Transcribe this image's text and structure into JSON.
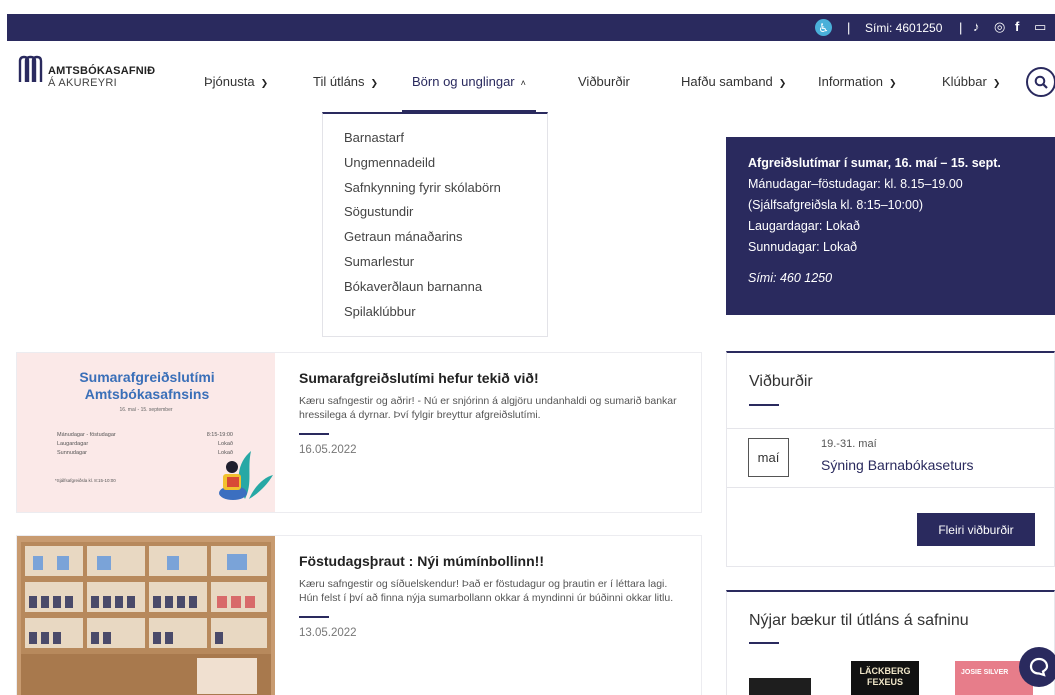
{
  "topbar": {
    "accessibility_icon": "accessibility-icon",
    "phone": "Sími: 4601250",
    "social": [
      "tiktok-icon",
      "instagram-icon",
      "facebook-icon",
      "youtube-icon"
    ]
  },
  "brand": {
    "name": "AMTSBÓKASAFNIÐ",
    "sub": "Á AKUREYRI"
  },
  "nav": {
    "items": [
      {
        "label": "Þjónusta",
        "has_dropdown": true
      },
      {
        "label": "Til útláns",
        "has_dropdown": true
      },
      {
        "label": "Börn og unglingar",
        "has_dropdown": true,
        "open": true
      },
      {
        "label": "Viðburðir",
        "has_dropdown": false
      },
      {
        "label": "Hafðu samband",
        "has_dropdown": true
      },
      {
        "label": "Information",
        "has_dropdown": true
      },
      {
        "label": "Klúbbar",
        "has_dropdown": true
      }
    ],
    "search_icon": "search-icon"
  },
  "dropdown": {
    "items": [
      "Barnastarf",
      "Ungmennadeild",
      "Safnkynning fyrir skólabörn",
      "Sögustundir",
      "Getraun mánaðarins",
      "Sumarlestur",
      "Bókaverðlaun barnanna",
      "Spilaklúbbur"
    ]
  },
  "hours": {
    "title": "Afgreiðslutímar í sumar, 16. maí – 15. sept.",
    "lines": [
      "Mánudagar–föstudagar: kl. 8.15–19.00",
      "(Sjálfsafgreiðsla kl. 8:15–10:00)",
      "Laugardagar: Lokað",
      "Sunnudagar: Lokað"
    ],
    "phone": "Sími: 460 1250"
  },
  "news": [
    {
      "title": "Sumarafgreiðslutími hefur tekið við!",
      "text": "Kæru safngestir og aðrir! - Nú er snjórinn á algjöru undanhaldi og sumarið bankar hressilega á dyrnar. Því fylgir breyttur afgreiðslutími.",
      "date": "16.05.2022",
      "image": {
        "title": "Sumarafgreiðslutími Amtsbókasafnsins",
        "range": "16. maí - 15. september",
        "rows": [
          {
            "day": "Mánudagar - föstudagar",
            "time": "8:15-19:00"
          },
          {
            "day": "Laugardagar",
            "time": "Lokað"
          },
          {
            "day": "Sunnudagar",
            "time": "Lokað"
          }
        ],
        "note": "*Sjálfsafgreiðsla kl. 8:15-10:00"
      }
    },
    {
      "title": "Föstudagsþraut : Nýi múmínbollinn!!",
      "text": "Kæru safngestir og síðuelskendur! Það er föstudagur og þrautin er í léttara lagi. Hún felst í því að finna nýja sumarbollann okkar á myndinni úr búðinni okkar litlu.",
      "date": "13.05.2022"
    }
  ],
  "events": {
    "title": "Viðburðir",
    "items": [
      {
        "month": "maí",
        "date": "19.-31. maí",
        "name": "Sýning Barnabókaseturs"
      }
    ],
    "more_label": "Fleiri viðburðir"
  },
  "new_books": {
    "title": "Nýjar bækur til útláns á safninu",
    "covers": [
      "LÄCKBERG",
      "FEXEUS",
      "JOSIE SILVER"
    ]
  },
  "colors": {
    "primary": "#2a2a5e",
    "accent": "#4ab0d9",
    "poster_bg": "#fbe9e8"
  }
}
